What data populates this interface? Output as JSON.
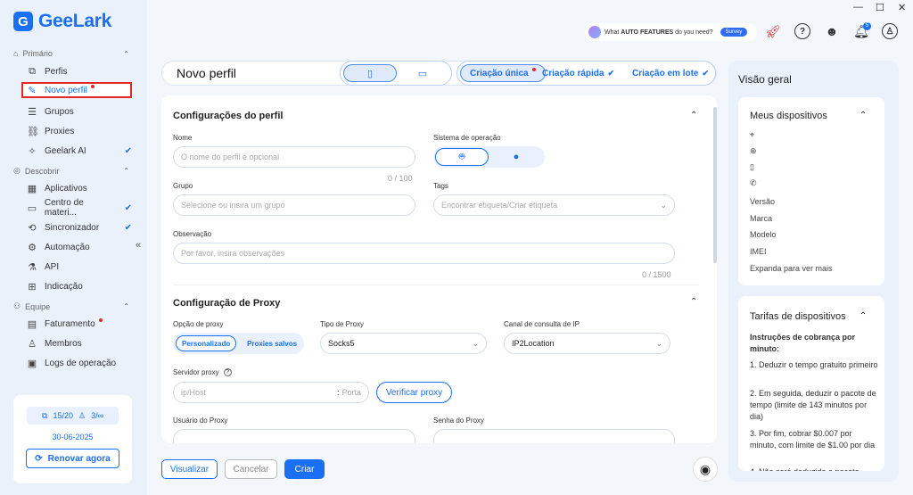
{
  "app": {
    "name": "GeeLark",
    "logo_letter": "G"
  },
  "window_controls": {
    "minimize": "—",
    "maximize": "☐",
    "close": "✕"
  },
  "sidebar": {
    "sections": [
      {
        "label": "Primário",
        "items": [
          {
            "label": "Perfis"
          },
          {
            "label": "Novo perfil"
          },
          {
            "label": "Grupos"
          },
          {
            "label": "Proxies"
          },
          {
            "label": "Geelark AI"
          }
        ]
      },
      {
        "label": "Descobrir",
        "items": [
          {
            "label": "Aplicativos"
          },
          {
            "label": "Centro de materi..."
          },
          {
            "label": "Sincronizador"
          },
          {
            "label": "Automação"
          },
          {
            "label": "API"
          },
          {
            "label": "Indicação"
          }
        ]
      },
      {
        "label": "Equipe",
        "items": [
          {
            "label": "Faturamento"
          },
          {
            "label": "Membros"
          },
          {
            "label": "Logs de operação"
          }
        ]
      }
    ],
    "plan": {
      "profiles": "15/20",
      "members": "3/∞",
      "date": "30-06-2025",
      "renew_label": "Renovar agora"
    }
  },
  "topbar": {
    "survey_text_pre": "What ",
    "survey_text_bold": "AUTO FEATURES",
    "survey_text_post": " do you need?",
    "survey_button": "Survey",
    "notif_count": "5"
  },
  "header": {
    "title": "Novo perfil",
    "tabs": [
      "Criação única",
      "Criação rápida",
      "Criação em lote"
    ]
  },
  "profile_section": {
    "title": "Configurações do perfil",
    "name_label": "Nome",
    "name_placeholder": "O nome do perfil é opcional",
    "name_counter": "0 / 100",
    "os_label": "Sistema de operação",
    "group_label": "Grupo",
    "group_placeholder": "Selecione ou insira um grupo",
    "tags_label": "Tags",
    "tags_placeholder": "Encontrar etiqueta/Criar etiqueta",
    "notes_label": "Observação",
    "notes_placeholder": "Por favor, insira observações",
    "notes_counter": "0 / 1500"
  },
  "proxy_section": {
    "title": "Configuração de Proxy",
    "option_label": "Opção de proxy",
    "options": [
      "Personalizado",
      "Proxies salvos"
    ],
    "type_label": "Tipo de Proxy",
    "type_value": "Socks5",
    "ip_channel_label": "Canal de consulta de IP",
    "ip_channel_value": "IP2Location",
    "server_label": "Servidor proxy",
    "host_placeholder": "ip/Host",
    "port_placeholder": "Porta",
    "verify_button": "Verificar proxy",
    "user_label": "Usuário do Proxy",
    "password_label": "Senha do Proxy"
  },
  "footer": {
    "preview": "Visualizar",
    "cancel": "Cancelar",
    "create": "Criar"
  },
  "overview": {
    "title": "Visão geral",
    "devices_title": "Meus dispositivos",
    "device_fields": [
      "Versão",
      "Marca",
      "Modelo",
      "IMEI",
      "Expanda para ver mais"
    ],
    "rates_title": "Tarifas de dispositivos",
    "rates_heading": "Instruções de cobrança por minuto:",
    "rates_steps": [
      "1. Deduzir o tempo gratuito primeiro",
      "2. Em seguida, deduzir o pacote de tempo (limite de 143 minutos por dia)",
      "3. Por fim, cobrar $0.007 por minuto, com limite de $1.00 por dia",
      "4. Não será deduzido o pacote..."
    ]
  },
  "colors": {
    "accent": "#1a6ff3",
    "highlight_border": "#e02a2a",
    "sidebar_bg": "#eaf1fb"
  }
}
